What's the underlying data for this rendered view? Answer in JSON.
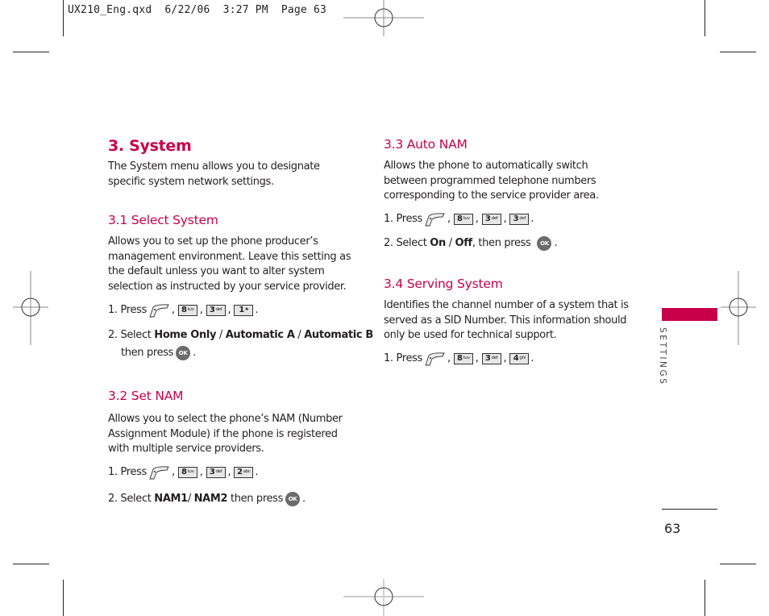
{
  "slug": "UX210_Eng.qxd  6/22/06  3:27 PM  Page 63",
  "side_tab": {
    "label": "SETTINGS",
    "color": "#c8004a"
  },
  "page_number": "63",
  "accent_color": "#c8004a",
  "icons": {
    "menu": "menu-soft-key-icon",
    "ok": "OK",
    "keys": {
      "k8": {
        "num": "8",
        "letters": "tuv"
      },
      "k3": {
        "num": "3",
        "letters": "def"
      },
      "k1": {
        "num": "1",
        "letters": ""
      },
      "k2": {
        "num": "2",
        "letters": "abc"
      },
      "k4": {
        "num": "4",
        "letters": "ghi"
      }
    }
  },
  "section": {
    "title": "3. System",
    "intro": "The System menu allows you to designate specific system network settings."
  },
  "s31": {
    "title": "3.1 Select System",
    "body": "Allows you to set up the phone producer’s management environment. Leave this setting as the default unless you want to alter system selection as instructed by your service provider.",
    "step1_prefix": "1. Press",
    "step2_prefix": "2. Select",
    "opt1": "Home Only",
    "sep": " / ",
    "opt2": "Automatic A",
    "opt3": "Automatic B",
    "step2_suffix": "then press"
  },
  "s32": {
    "title": "3.2 Set NAM",
    "body": "Allows you to select the phone’s NAM (Number Assignment Module) if the phone is registered with multiple service providers.",
    "step1_prefix": "1. Press",
    "step2_prefix": "2. Select",
    "opt1": "NAM1",
    "sep": "/ ",
    "opt2": "NAM2",
    "step2_suffix": "then press"
  },
  "s33": {
    "title": "3.3 Auto NAM",
    "body": "Allows the phone to automatically switch between programmed telephone numbers corresponding to the service provider area.",
    "step1_prefix": "1. Press",
    "step2_prefix": "2. Select",
    "opt1": "On",
    "sep": " / ",
    "opt2": "Off",
    "step2_suffix": ", then press"
  },
  "s34": {
    "title": "3.4 Serving System",
    "body": "Identifies the channel number of a system that is served as a SID Number. This information should only be used for technical support.",
    "step1_prefix": "1. Press"
  },
  "punct": {
    "comma": ",",
    "period": "."
  }
}
